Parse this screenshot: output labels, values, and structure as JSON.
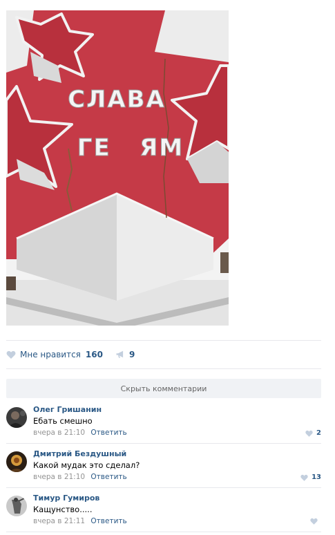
{
  "photo": {
    "sign_line1": "СЛАВА",
    "sign_line2": "ГЕ   ЯМ"
  },
  "actions": {
    "like_label": "Мне нравится",
    "like_count": "160",
    "share_count": "9"
  },
  "hide_comments_label": "Скрыть комментарии",
  "comments": [
    {
      "author": "Олег Гришанин",
      "text": "Ебать смешно",
      "date": "вчера в 21:10",
      "reply": "Ответить",
      "likes": "2"
    },
    {
      "author": "Дмитрий Бездушный",
      "text": "Какой мудак это сделал?",
      "date": "вчера в 21:10",
      "reply": "Ответить",
      "likes": "13"
    },
    {
      "author": "Тимур Гумиров",
      "text": "Кащунство.....",
      "date": "вчера в 21:11",
      "reply": "Ответить",
      "likes": ""
    }
  ],
  "colors": {
    "link": "#2a5885",
    "muted": "#939393",
    "icon": "#c3cfde",
    "star_red": "#c53a47",
    "button_bg": "#f0f2f5"
  }
}
